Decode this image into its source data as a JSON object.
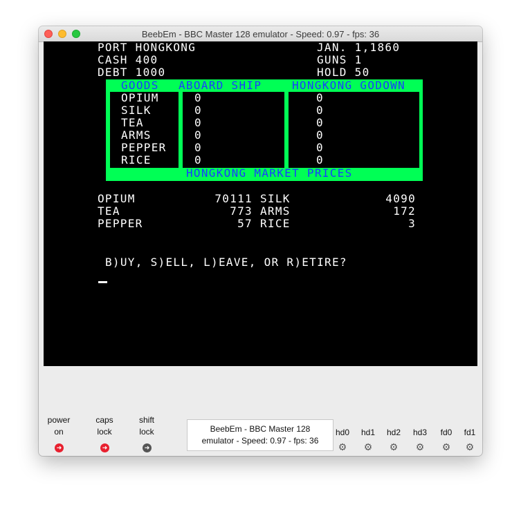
{
  "window": {
    "title": "BeebEm - BBC Master 128 emulator - Speed: 0.97 - fps: 36"
  },
  "screen": {
    "status": {
      "port": "PORT HONGKONG",
      "date": "JAN. 1,1860",
      "cash": "CASH 400",
      "guns": "GUNS 1",
      "debt": "DEBT 1000",
      "hold": "HOLD 50"
    },
    "inventory": {
      "headers": {
        "goods": "GOODS",
        "ship": "ABOARD SHIP",
        "godown": "HONGKONG GODOWN"
      },
      "rows": [
        {
          "name": "OPIUM",
          "ship": "0",
          "godown": "0"
        },
        {
          "name": "SILK",
          "ship": "0",
          "godown": "0"
        },
        {
          "name": "TEA",
          "ship": "0",
          "godown": "0"
        },
        {
          "name": "ARMS",
          "ship": "0",
          "godown": "0"
        },
        {
          "name": "PEPPER",
          "ship": "0",
          "godown": "0"
        },
        {
          "name": "RICE",
          "ship": "0",
          "godown": "0"
        }
      ],
      "market_title": "HONGKONG MARKET PRICES"
    },
    "prices": [
      {
        "name1": "OPIUM",
        "price1": "70111",
        "name2": "SILK",
        "price2": "4090"
      },
      {
        "name1": "TEA",
        "price1": "773",
        "name2": "ARMS",
        "price2": "172"
      },
      {
        "name1": "PEPPER",
        "price1": "57",
        "name2": "RICE",
        "price2": "3"
      }
    ],
    "prompt": "B)UY, S)ELL, L)EAVE, OR R)ETIRE?"
  },
  "statusbar": {
    "power": {
      "line1": "power",
      "line2": "on"
    },
    "caps": {
      "line1": "caps",
      "line2": "lock"
    },
    "shift": {
      "line1": "shift",
      "line2": "lock"
    },
    "tooltip": {
      "line1": "BeebEm - BBC Master 128",
      "line2": "emulator - Speed: 0.97 - fps: 36"
    },
    "drives": [
      "hd0",
      "hd1",
      "hd2",
      "hd3",
      "fd0",
      "fd1"
    ]
  },
  "colors": {
    "frame_green": "#00ff55",
    "header_blue": "#1a3cff",
    "led_red": "#e8202f",
    "led_off": "#555555"
  },
  "icons": {
    "led": "arrow-circle-icon",
    "drive": "gear-icon"
  }
}
